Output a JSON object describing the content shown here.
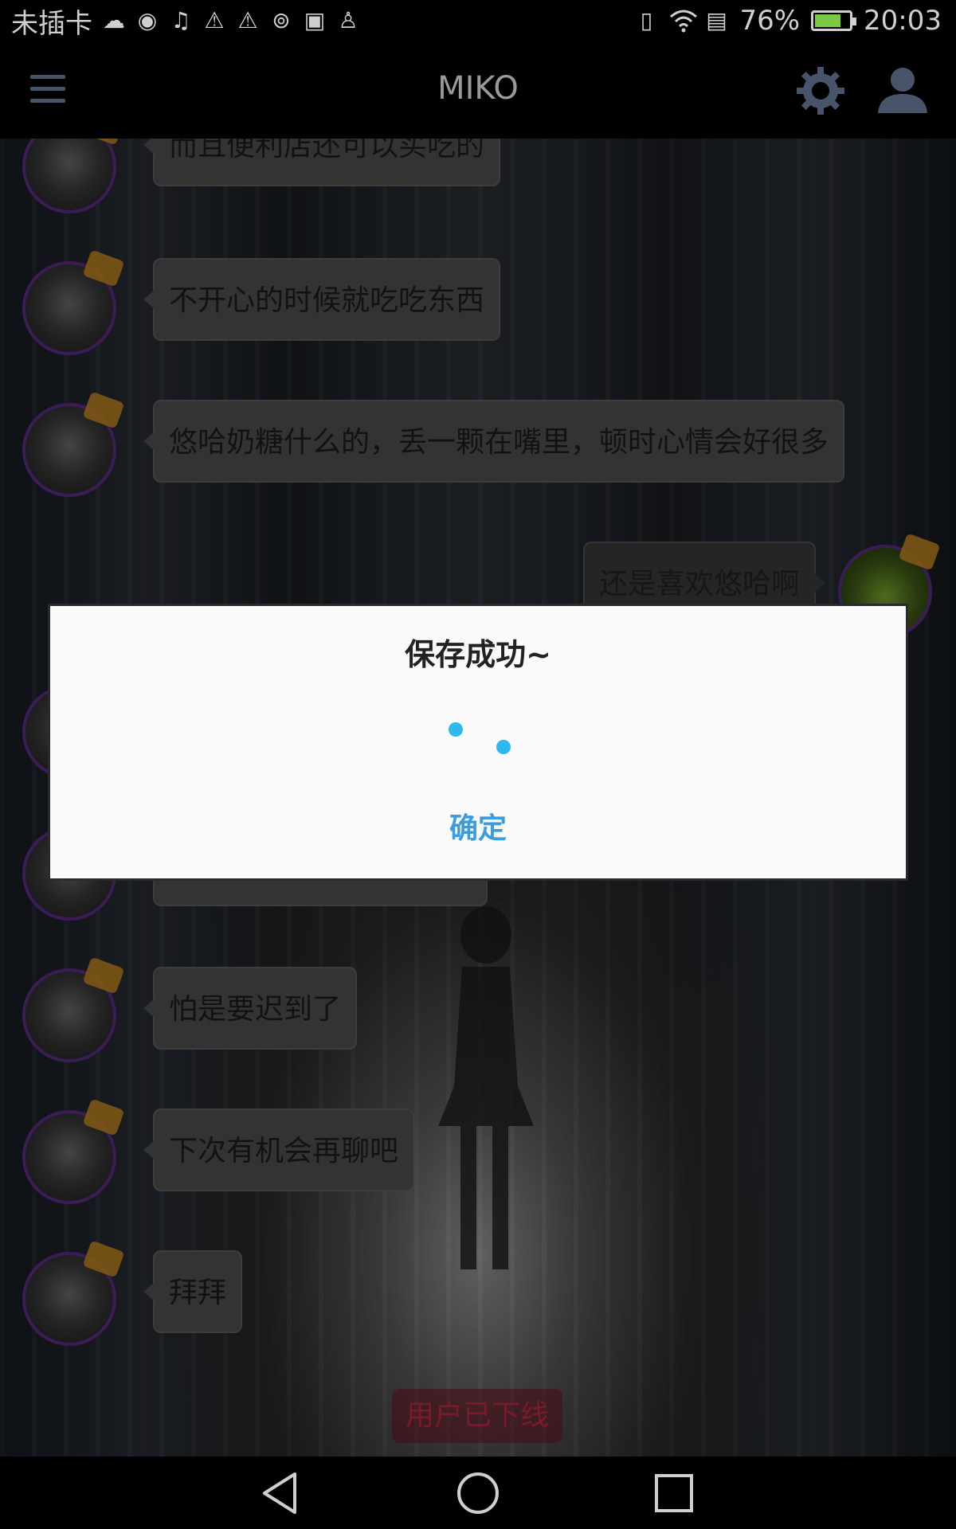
{
  "status_bar": {
    "carrier": "未插卡",
    "battery": "76%",
    "battery_level": 0.76,
    "time": "20:03",
    "icons": [
      "weather-icon",
      "chat-icon",
      "music-icon",
      "alert-icon",
      "alert-icon",
      "hotspot-icon",
      "image-icon",
      "cleaner-icon",
      "vibrate-icon",
      "wifi-icon",
      "sim-icon"
    ]
  },
  "app_bar": {
    "title": "MIKO",
    "icons": [
      "menu-icon",
      "gear-icon",
      "user-icon"
    ]
  },
  "messages": [
    {
      "side": "left",
      "text": "而且便利店还可以买吃的"
    },
    {
      "side": "left",
      "text": "不开心的时候就吃吃东西"
    },
    {
      "side": "left",
      "text": "悠哈奶糖什么的，丢一颗在嘴里，顿时心情会好很多"
    },
    {
      "side": "right",
      "text": "还是喜欢悠哈啊"
    },
    {
      "side": "left",
      "text": ""
    },
    {
      "side": "left",
      "text": ""
    },
    {
      "side": "left",
      "text": "怕是要迟到了"
    },
    {
      "side": "left",
      "text": "下次有机会再聊吧"
    },
    {
      "side": "left",
      "text": "拜拜"
    }
  ],
  "offline_label": "用户已下线",
  "dialog": {
    "title": "保存成功~",
    "confirm": "确定"
  },
  "colors": {
    "accent": "#3a9de0",
    "spinner": "#2db8ee",
    "avatar_ring": "#5b2b86",
    "offline_text": "#7a1a2c"
  }
}
